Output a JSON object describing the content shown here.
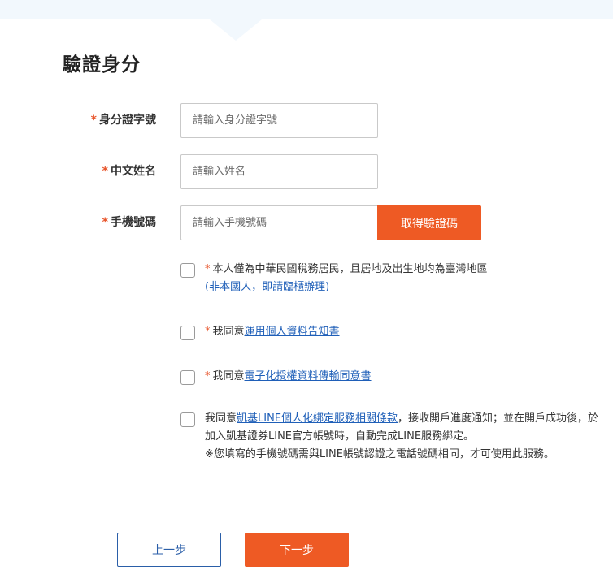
{
  "title": "驗證身分",
  "required_mark": "*",
  "fields": {
    "id_number": {
      "label": "身分證字號",
      "placeholder": "請輸入身分證字號",
      "value": ""
    },
    "chinese_name": {
      "label": "中文姓名",
      "placeholder": "請輸入姓名",
      "value": ""
    },
    "mobile": {
      "label": "手機號碼",
      "placeholder": "請輸入手機號碼",
      "value": "",
      "otp_button": "取得驗證碼"
    }
  },
  "agreements": [
    {
      "required": true,
      "checked": false,
      "text": "本人僅為中華民國稅務居民，且居地及出生地均為臺灣地區",
      "link": "(非本國人，即請臨櫃辦理)"
    },
    {
      "required": true,
      "checked": false,
      "prefix": "我同意",
      "link": "運用個人資料告知書"
    },
    {
      "required": true,
      "checked": false,
      "prefix": "我同意",
      "link": "電子化授權資料傳輸同意書"
    },
    {
      "required": false,
      "checked": false,
      "prefix": "我同意",
      "link": "凱基LINE個人化綁定服務相關條款",
      "suffix": "，接收開戶進度通知；並在開戶成功後，於加入凱基證券LINE官方帳號時，自動完成LINE服務綁定。",
      "note": "※您填寫的手機號碼需與LINE帳號認證之電話號碼相同，才可使用此服務。"
    }
  ],
  "buttons": {
    "prev": "上一步",
    "next": "下一步"
  },
  "colors": {
    "accent": "#ee5a24",
    "link": "#1f5fb8",
    "required": "#e8542a",
    "banner": "#f2f8fd",
    "prev_border": "#2a5ea8"
  }
}
